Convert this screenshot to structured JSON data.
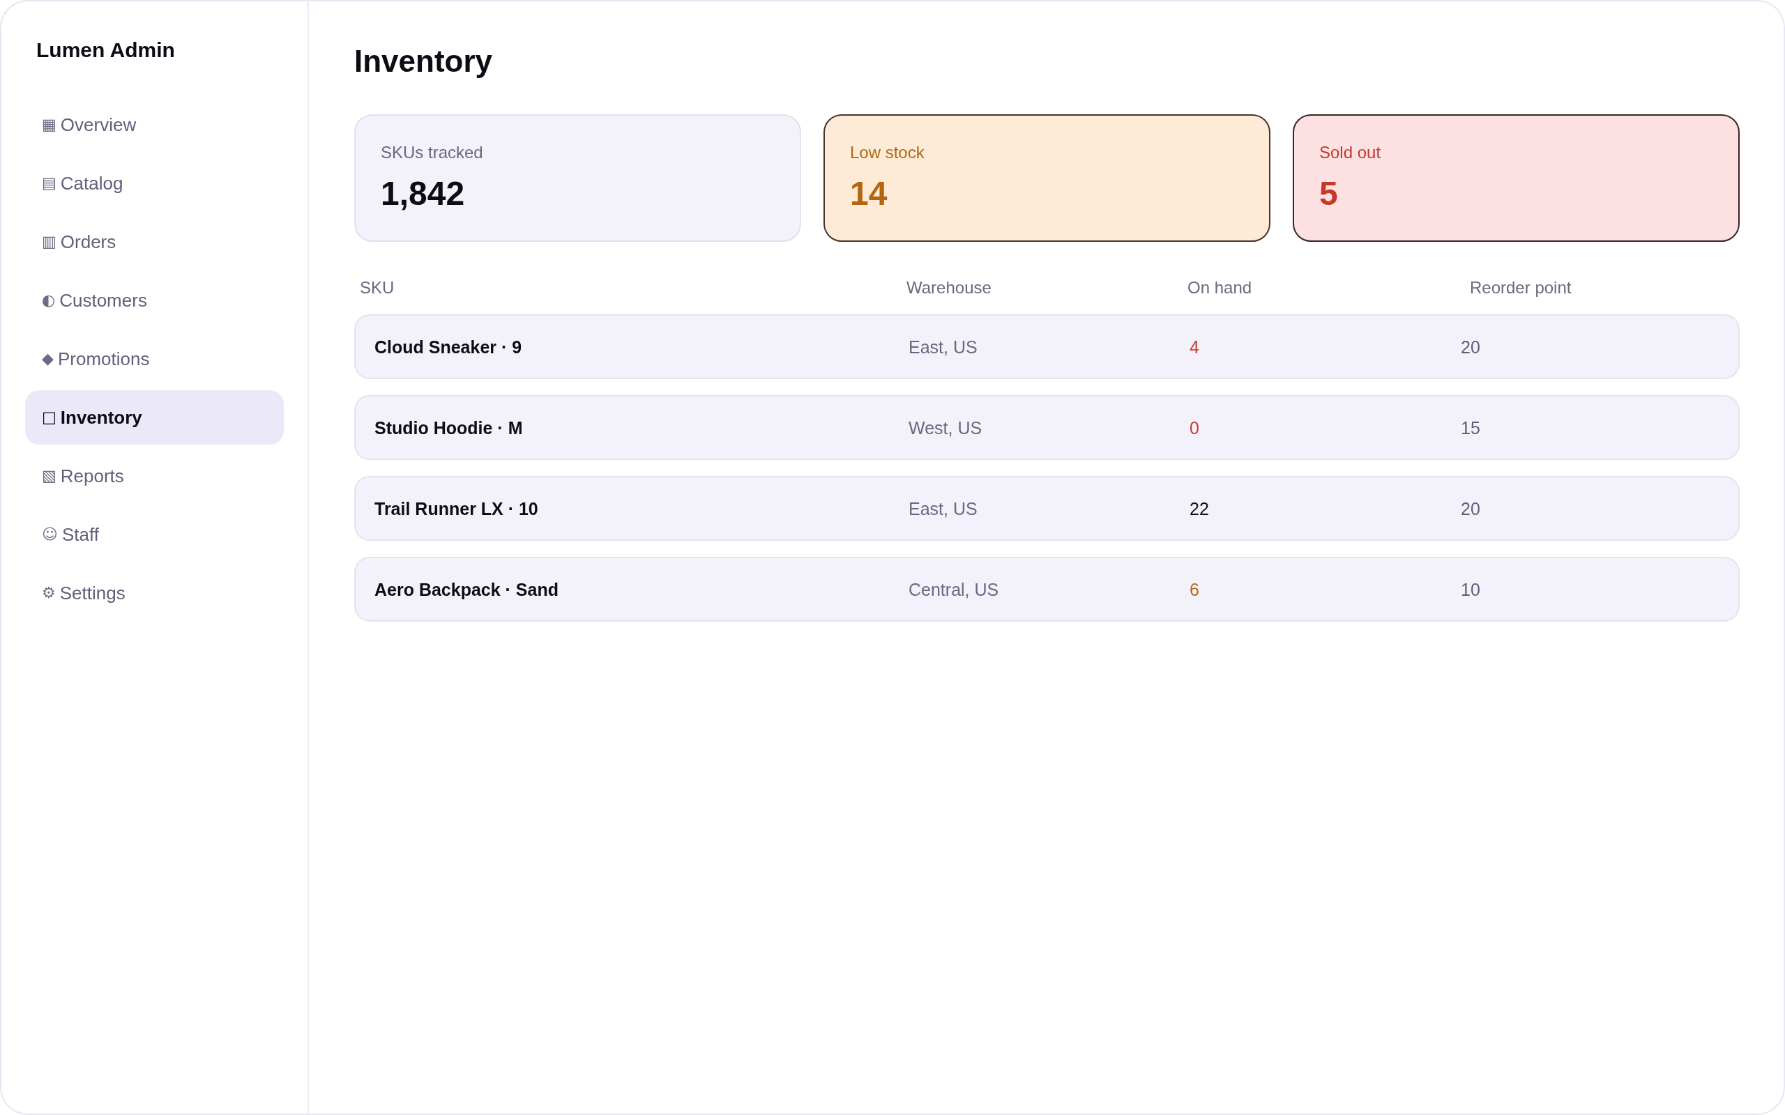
{
  "sidebar": {
    "title": "Lumen Admin",
    "items": [
      {
        "icon": "▦",
        "label": "Overview",
        "selected": false
      },
      {
        "icon": "▤",
        "label": "Catalog",
        "selected": false
      },
      {
        "icon": "▥",
        "label": "Orders",
        "selected": false
      },
      {
        "icon": "◐",
        "label": "Customers",
        "selected": false
      },
      {
        "icon": "◆",
        "label": "Promotions",
        "selected": false
      },
      {
        "icon": "□",
        "label": "Inventory",
        "selected": true
      },
      {
        "icon": "▧",
        "label": "Reports",
        "selected": false
      },
      {
        "icon": "☺",
        "label": "Staff",
        "selected": false
      },
      {
        "icon": "⚙",
        "label": "Settings",
        "selected": false
      }
    ]
  },
  "page": {
    "title": "Inventory"
  },
  "stats": [
    {
      "kind": "neutral",
      "label": "SKUs tracked",
      "value": "1,842"
    },
    {
      "kind": "warning",
      "label": "Low stock",
      "value": "14"
    },
    {
      "kind": "danger",
      "label": "Sold out",
      "value": "5"
    }
  ],
  "table": {
    "columns": [
      "SKU",
      "Warehouse",
      "On hand",
      "Reorder point"
    ],
    "rows": [
      {
        "sku": "Cloud Sneaker · 9",
        "warehouse": "East, US",
        "on_hand": {
          "value": "4",
          "color": "#c63d2f"
        },
        "reorder_point": "20"
      },
      {
        "sku": "Studio Hoodie · M",
        "warehouse": "West, US",
        "on_hand": {
          "value": "0",
          "color": "#c63d2f"
        },
        "reorder_point": "15"
      },
      {
        "sku": "Trail Runner LX · 10",
        "warehouse": "East, US",
        "on_hand": {
          "value": "22",
          "color": "#111111"
        },
        "reorder_point": "20"
      },
      {
        "sku": "Aero Backpack · Sand",
        "warehouse": "Central, US",
        "on_hand": {
          "value": "6",
          "color": "#b8690f"
        },
        "reorder_point": "10"
      }
    ]
  }
}
